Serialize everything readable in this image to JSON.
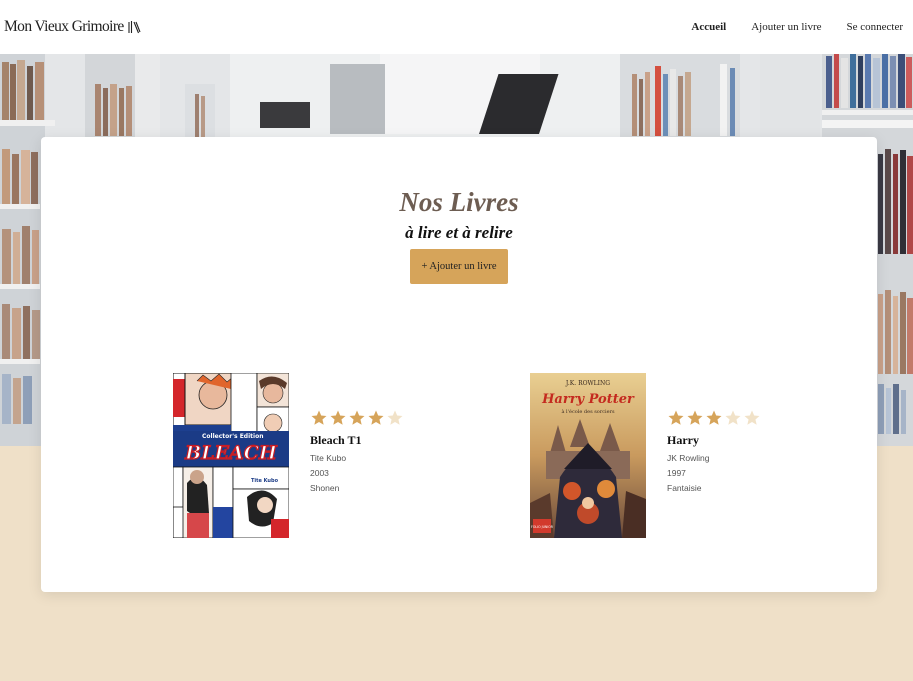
{
  "header": {
    "logo_text": "Mon Vieux Grimoire",
    "nav": [
      {
        "label": "Accueil",
        "active": true
      },
      {
        "label": "Ajouter un livre",
        "active": false
      },
      {
        "label": "Se connecter",
        "active": false
      }
    ]
  },
  "main": {
    "title": "Nos Livres",
    "subtitle": "à lire et à relire",
    "add_button_label": "+ Ajouter un livre"
  },
  "books": [
    {
      "title": "Bleach T1",
      "author": "Tite Kubo",
      "year": "2003",
      "genre": "Shonen",
      "rating": 4,
      "rating_max": 5,
      "cover_text": {
        "edition": "Collector's Edition",
        "series": "BLEACH",
        "author": "Tite Kubo"
      }
    },
    {
      "title": "Harry",
      "author": "JK Rowling",
      "year": "1997",
      "genre": "Fantaisie",
      "rating": 3,
      "rating_max": 5,
      "cover_text": {
        "author": "J.K. ROWLING",
        "series": "Harry Potter",
        "subtitle": "à l'école des sorciers",
        "publisher": "FOLIO JUNIOR"
      }
    }
  ],
  "colors": {
    "accent": "#d6a45a",
    "star_filled": "#d6a45a",
    "star_empty": "#f1e2c8",
    "title_color": "#6d5d52",
    "page_bg": "#efe0c8"
  },
  "icons": {
    "logo": "open-book-icon",
    "star": "star-icon"
  }
}
